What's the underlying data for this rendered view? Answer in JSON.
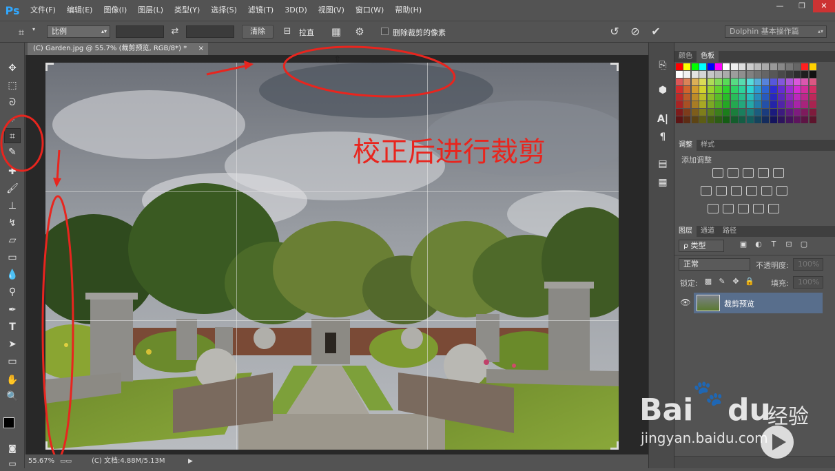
{
  "app": {
    "logo": "Ps"
  },
  "menu": [
    "文件(F)",
    "编辑(E)",
    "图像(I)",
    "图层(L)",
    "类型(Y)",
    "选择(S)",
    "滤镜(T)",
    "3D(D)",
    "视图(V)",
    "窗口(W)",
    "帮助(H)"
  ],
  "window_controls": {
    "minimize": "—",
    "restore": "❐",
    "close": "✕"
  },
  "options": {
    "ratio_select": "比例",
    "clear_button": "清除",
    "straighten_label": "拉直",
    "delete_cropped_label": "删除裁剪的像素",
    "workspace_select": "Dolphin 基本操作篇"
  },
  "document": {
    "tab_title": "(C) Garden.jpg @ 55.7% (裁剪预览, RGB/8*) *",
    "tab_close": "×"
  },
  "annotation": {
    "text": "校正后进行裁剪",
    "color": "#e8251e"
  },
  "status": {
    "zoom": "55.67%",
    "doc_info": "(C) 文档:4.88M/5.13M"
  },
  "panels": {
    "color_tabs": [
      "颜色",
      "色板"
    ],
    "adjust_tabs": [
      "调整",
      "样式"
    ],
    "adjust_title": "添加调整",
    "layers_tabs": [
      "图层",
      "通道",
      "路径"
    ],
    "filter_label": "ρ 类型",
    "blend_mode": "正常",
    "opacity_label": "不透明度:",
    "opacity_value": "100%",
    "lock_label": "锁定:",
    "fill_label": "填充:",
    "fill_value": "100%",
    "layer_name": "裁剪预览"
  },
  "watermark": {
    "brand": "Bai",
    "brand2": "du",
    "suffix": "经验",
    "url": "jingyan.baidu.com"
  },
  "icons": [
    "crop-icon",
    "swap-icon",
    "straighten-icon",
    "grid-icon",
    "gear-icon",
    "reset-icon",
    "cancel-icon",
    "commit-icon",
    "move-icon",
    "marquee-icon",
    "lasso-icon",
    "eyedropper-icon",
    "brush-icon",
    "stamp-icon",
    "eraser-icon",
    "gradient-icon",
    "pen-icon",
    "type-icon",
    "hand-icon",
    "zoom-icon",
    "eye-icon"
  ]
}
